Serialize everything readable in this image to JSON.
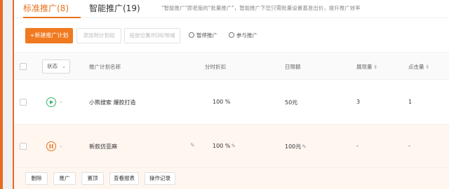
{
  "tabs": {
    "standard": "标准推广(8)",
    "smart": "智能推广(19)",
    "note": "\"智能推广\"即老版的\"批量推广\"，智能推广下您只需批量设置基准出价，提升推广效率"
  },
  "toolbar": {
    "new_plan": "+新建推广计划",
    "add_to_group": "添加到计划组",
    "placement_settings": "投放位置/时间/地域",
    "pause": "暂停推广",
    "join": "参与推广"
  },
  "table": {
    "status_filter": "状态",
    "headers": {
      "name": "推广计划名称",
      "time_discount": "分时折扣",
      "daily_budget": "日限额",
      "impressions": "展现量",
      "clicks": "点击量"
    },
    "rows": [
      {
        "status": "active",
        "name": "小熊搜索 爆款打造",
        "time_discount": "100 %",
        "daily_budget": "50元",
        "impressions": "3",
        "clicks": "1"
      },
      {
        "status": "paused",
        "name": "新款仿亚麻",
        "time_discount": "100 %",
        "daily_budget": "100元",
        "impressions": "-",
        "clicks": "-"
      }
    ]
  },
  "row_actions": {
    "delete": "删除",
    "promote": "推广",
    "pin_top": "置顶",
    "view_report": "查看报表",
    "op_log": "操作记录"
  },
  "colors": {
    "accent": "#e8701c",
    "active_status": "#3cb371",
    "hover_row": "#fff6f0"
  }
}
